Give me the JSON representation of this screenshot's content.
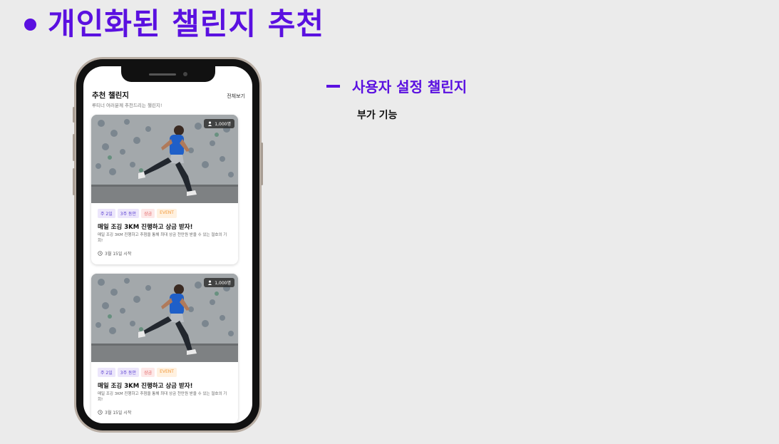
{
  "slide": {
    "title": "개인화된 챌린지 추천",
    "section_title": "사용자 설정 챌린지",
    "section_subtitle": "부가 기능",
    "accent_color": "#5a10e0"
  },
  "app": {
    "header_title": "추천 챌린지",
    "view_all": "전체보기",
    "subtitle": "루티너 여러분께 추천드리는 챌린지!",
    "cards": [
      {
        "participants": "1,000명",
        "tags": [
          "주 2일",
          "3주 동안",
          "상금",
          "EVENT"
        ],
        "title": "매일 조깅 3KM 진행하고 상금 받자!",
        "description": "매일 조깅 3KM 진행하고 추첨을 통해 최대 상금 천만원 받을 수 있는 절호의 기회!",
        "date": "3월 15일 시작",
        "participants_icon": "person-icon",
        "date_icon": "clock-icon"
      },
      {
        "participants": "1,000명",
        "tags": [
          "주 2일",
          "3주 동안",
          "상금",
          "EVENT"
        ],
        "title": "매일 조깅 3KM 진행하고 상금 받자!",
        "description": "매일 조깅 3KM 진행하고 추첨을 통해 최대 상금 천만원 받을 수 있는 절호의 기회!",
        "date": "3월 15일 시작",
        "participants_icon": "person-icon",
        "date_icon": "clock-icon"
      }
    ]
  }
}
